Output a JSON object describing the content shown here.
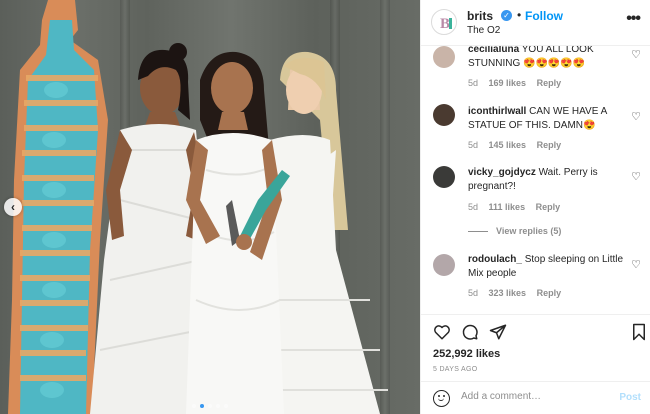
{
  "post": {
    "username": "brits",
    "separator": "•",
    "follow_label": "Follow",
    "location": "The O2",
    "more_label": "•••"
  },
  "carousel": {
    "prev_arrow": "‹",
    "dot_count": 5,
    "active_dot": 1
  },
  "comments": [
    {
      "user": "cecilialuna",
      "text": "YOU ALL LOOK STUNNING 😍😍😍😍😍",
      "time": "5d",
      "likes": "169 likes",
      "reply": "Reply"
    },
    {
      "user": "iconthirlwall",
      "text": "CAN WE HAVE A STATUE OF THIS. DAMN😍",
      "time": "5d",
      "likes": "145 likes",
      "reply": "Reply"
    },
    {
      "user": "vicky_gojdycz",
      "text": "Wait. Perry is pregnant?!",
      "time": "5d",
      "likes": "111 likes",
      "reply": "Reply",
      "view_replies": "View replies (5)"
    },
    {
      "user": "rodoulach_",
      "text": "Stop sleeping on Little Mix people",
      "time": "5d",
      "likes": "323 likes",
      "reply": "Reply"
    }
  ],
  "actions": {
    "likes": "252,992 likes",
    "time_ago": "5 DAYS AGO"
  },
  "compose": {
    "placeholder": "Add a comment…",
    "post_label": "Post"
  },
  "colors": {
    "link_blue": "#0095f6",
    "muted": "#8e8e8e",
    "post_disabled": "#b2dffc"
  }
}
